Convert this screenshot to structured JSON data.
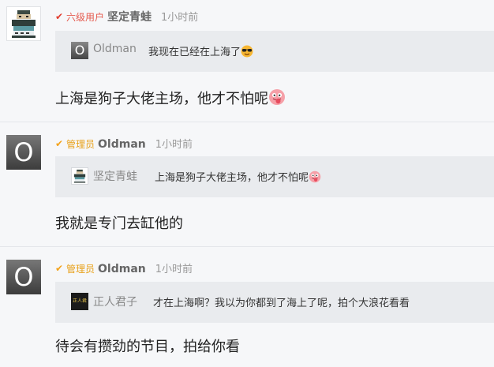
{
  "comments": [
    {
      "badge_icon": "v-red-icon",
      "level": "六级用户",
      "username": "坚定青蛙",
      "time": "1小时前",
      "quote_user": "Oldman",
      "quote_avatar_letter": "O",
      "quote_text": "我现在已经在上海了",
      "quote_emoji": "sunglasses-emoji-icon",
      "body": "上海是狗子大佬主场，他才不怕呢",
      "body_emoji": "tongue-emoji-icon"
    },
    {
      "badge_icon": "v-gold-icon",
      "level": "管理员",
      "username": "Oldman",
      "avatar_letter": "O",
      "time": "1小时前",
      "quote_user": "坚定青蛙",
      "quote_text": "上海是狗子大佬主场，他才不怕呢",
      "quote_emoji": "tongue-emoji-icon",
      "body": "我就是专门去缸他的"
    },
    {
      "badge_icon": "v-gold-icon",
      "level": "管理员",
      "username": "Oldman",
      "avatar_letter": "O",
      "time": "1小时前",
      "quote_user": "正人君子",
      "quote_avatar_text": "正人君子",
      "quote_text": "才在上海啊？我以为你都到了海上了呢，拍个大浪花看看",
      "body": "待会有攒劲的节目，拍给你看"
    }
  ],
  "colors": {
    "background": "#f6f7f9",
    "quote_background": "#e9ebee",
    "level_red": "#e55a4e",
    "level_gold": "#e8a11a"
  }
}
